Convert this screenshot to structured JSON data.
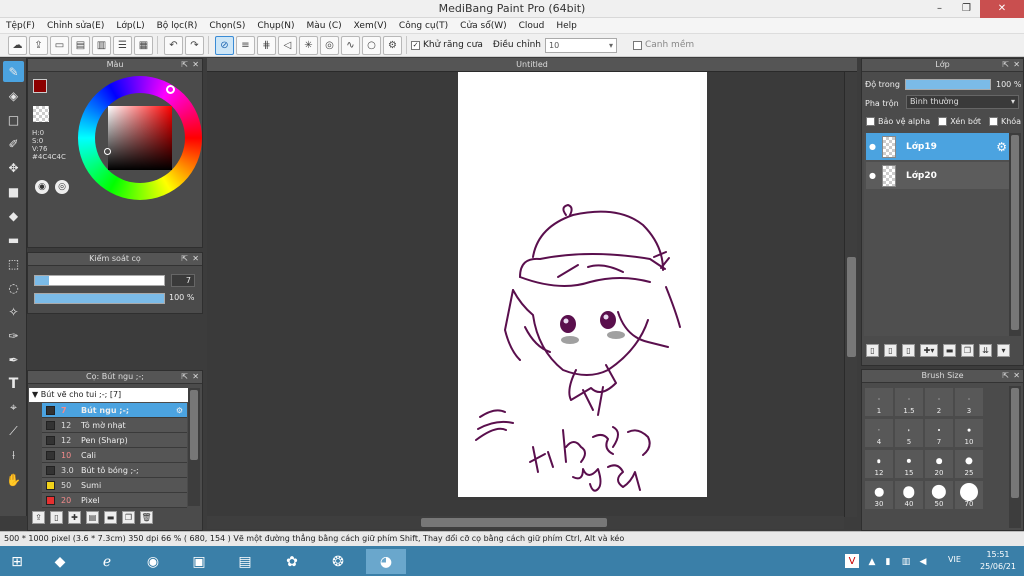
{
  "window": {
    "title": "MediBang Paint Pro (64bit)",
    "min": "–",
    "max": "❐",
    "close": "✕"
  },
  "menu": [
    "Tệp(F)",
    "Chỉnh sửa(E)",
    "Lớp(L)",
    "Bộ lọc(R)",
    "Chọn(S)",
    "Chụp(N)",
    "Màu (C)",
    "Xem(V)",
    "Công cụ(T)",
    "Cửa sổ(W)",
    "Cloud",
    "Help"
  ],
  "toolbar": {
    "antialias_label": "Khử răng cưa",
    "correction_label": "Điều chỉnh",
    "correction_value": "10",
    "snap_label": "Canh mềm"
  },
  "color_panel": {
    "title": "Màu",
    "hsv": [
      "H:0",
      "S:0",
      "V:76"
    ],
    "hex": "#4C4C4C",
    "main_color": "#8b0000"
  },
  "brush_control": {
    "title": "Kiểm soát cọ",
    "size": "7",
    "opacity": "100 %",
    "opacity_fraction": 1.0
  },
  "brush_panel": {
    "title": "Cọ: Bút ngu ;-;",
    "group": "Bút vẽ cho tui ;-; [7]",
    "items": [
      {
        "size": "7",
        "name": "Bút ngu ;-;",
        "color": "#333333",
        "selected": true
      },
      {
        "size": "12",
        "name": "Tô mờ nhạt",
        "color": "#333333"
      },
      {
        "size": "12",
        "name": "Pen (Sharp)",
        "color": "#333333"
      },
      {
        "size": "10",
        "name": "Cali",
        "color": "#333333"
      },
      {
        "size": "3.0",
        "name": "Bút tô bóng ;-;",
        "color": "#333333"
      },
      {
        "size": "50",
        "name": "Sumi",
        "color": "#f2d21a"
      },
      {
        "size": "20",
        "name": "Pixel",
        "color": "#e53030"
      }
    ]
  },
  "canvas": {
    "tab": "Untitled",
    "handwriting": [
      "Hoa tại 2k7",
      "cũng 2k7"
    ]
  },
  "layer_panel": {
    "title": "Lớp",
    "opacity_label": "Độ trong",
    "opacity": "100 %",
    "opacity_fraction": 1.0,
    "blend_label": "Pha trộn",
    "blend_value": "Bình thường",
    "protect_alpha": "Bảo vệ alpha",
    "clipping": "Xén bớt",
    "lock": "Khóa",
    "layers": [
      {
        "name": "Lớp19",
        "selected": true
      },
      {
        "name": "Lớp20",
        "selected": false
      }
    ]
  },
  "brush_size": {
    "title": "Brush Size",
    "sizes": [
      "1",
      "1.5",
      "2",
      "3",
      "4",
      "5",
      "7",
      "10",
      "12",
      "15",
      "20",
      "25",
      "30",
      "40",
      "50",
      "70"
    ]
  },
  "status": {
    "text": "500 * 1000 pixel   (3.6 * 7.3cm)   350 dpi   66 %   ( 680, 154 )   Vẽ một đường thẳng bằng cách giữ phím Shift, Thay đổi cỡ cọ bằng cách giữ phím Ctrl, Alt và kéo"
  },
  "taskbar": {
    "lang": "VIE",
    "time": "15:51",
    "date": "25/06/21"
  }
}
